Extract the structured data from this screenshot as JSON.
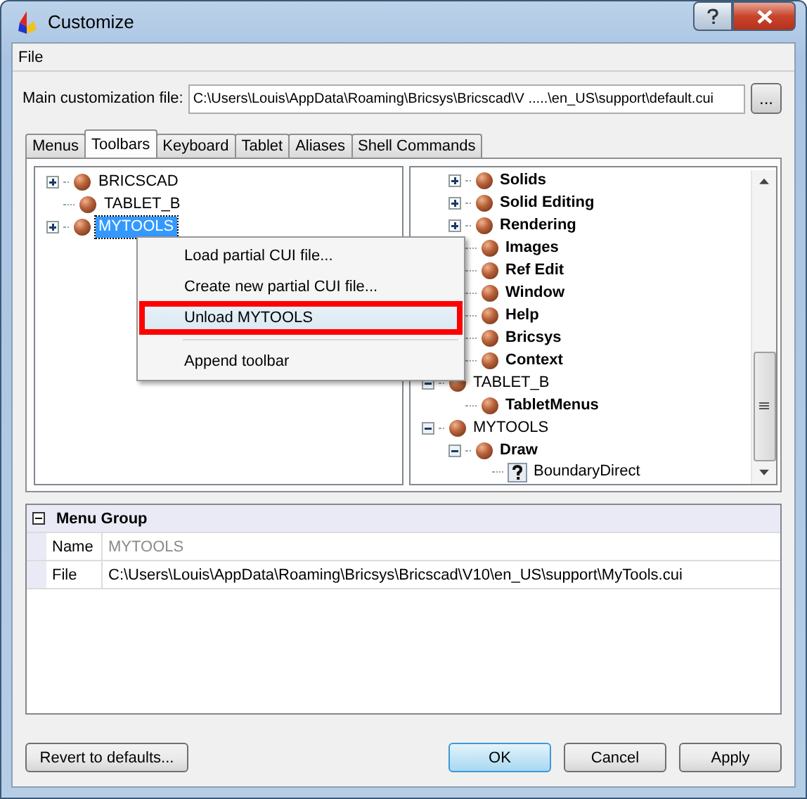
{
  "window": {
    "title": "Customize"
  },
  "menu": [
    {
      "label": "File"
    }
  ],
  "main_file": {
    "label": "Main customization file:",
    "value": "C:\\Users\\Louis\\AppData\\Roaming\\Bricsys\\Bricscad\\V .....\\en_US\\support\\default.cui",
    "browse": "..."
  },
  "tabs": [
    {
      "label": "Menus",
      "selected": false
    },
    {
      "label": "Toolbars",
      "selected": true
    },
    {
      "label": "Keyboard",
      "selected": false
    },
    {
      "label": "Tablet",
      "selected": false
    },
    {
      "label": "Aliases",
      "selected": false
    },
    {
      "label": "Shell Commands",
      "selected": false
    }
  ],
  "left_tree": [
    {
      "label": "BRICSCAD",
      "expanded": false,
      "bold": false,
      "selected": false,
      "kind": "toolbar"
    },
    {
      "label": "TABLET_B",
      "bold": false,
      "selected": false,
      "kind": "toolbar"
    },
    {
      "label": "MYTOOLS",
      "expanded": false,
      "bold": false,
      "selected": true,
      "kind": "toolbar"
    }
  ],
  "right_tree": [
    {
      "children": [
        {
          "label": "Solids",
          "expanded": false,
          "bold": true,
          "kind": "toolbar"
        },
        {
          "label": "Solid Editing",
          "expanded": false,
          "bold": true,
          "kind": "toolbar"
        },
        {
          "label": "Rendering",
          "expanded": false,
          "bold": true,
          "kind": "toolbar"
        },
        {
          "label": "Images",
          "bold": true,
          "kind": "toolbar"
        },
        {
          "label": "Ref Edit",
          "bold": true,
          "kind": "toolbar"
        },
        {
          "label": "Window",
          "bold": true,
          "kind": "toolbar"
        },
        {
          "label": "Help",
          "bold": true,
          "kind": "toolbar"
        },
        {
          "label": "Bricsys",
          "bold": true,
          "kind": "toolbar"
        },
        {
          "label": "Context",
          "bold": true,
          "kind": "toolbar"
        }
      ]
    },
    {
      "label": "TABLET_B",
      "expanded": true,
      "bold": false,
      "kind": "toolbar",
      "children": [
        {
          "label": "TabletMenus",
          "bold": true,
          "kind": "toolbar"
        }
      ]
    },
    {
      "label": "MYTOOLS",
      "expanded": true,
      "bold": false,
      "kind": "toolbar",
      "children": [
        {
          "label": "Draw",
          "expanded": true,
          "bold": true,
          "kind": "toolbar",
          "children": [
            {
              "label": "BoundaryDirect",
              "bold": false,
              "kind": "command"
            }
          ]
        }
      ]
    }
  ],
  "context_menu": [
    {
      "label": "Load partial CUI file...",
      "selected": false,
      "annotated": false
    },
    {
      "label": "Create new partial CUI file...",
      "selected": false,
      "annotated": false
    },
    {
      "label": "Unload MYTOOLS",
      "selected": true,
      "annotated": true
    },
    {
      "kind": "separator"
    },
    {
      "label": "Append toolbar",
      "selected": false,
      "annotated": false
    }
  ],
  "properties": {
    "group": "Menu Group",
    "expanded": true,
    "rows": [
      {
        "name": "Name",
        "value": "MYTOOLS",
        "read_only": true
      },
      {
        "name": "File",
        "value": "C:\\Users\\Louis\\AppData\\Roaming\\Bricsys\\Bricscad\\V10\\en_US\\support\\MyTools.cui",
        "read_only": false
      }
    ]
  },
  "buttons": [
    {
      "label": "Revert to defaults...",
      "default": false
    },
    {
      "label": "OK",
      "default": true
    },
    {
      "label": "Cancel",
      "default": false
    },
    {
      "label": "Apply",
      "default": false
    }
  ]
}
